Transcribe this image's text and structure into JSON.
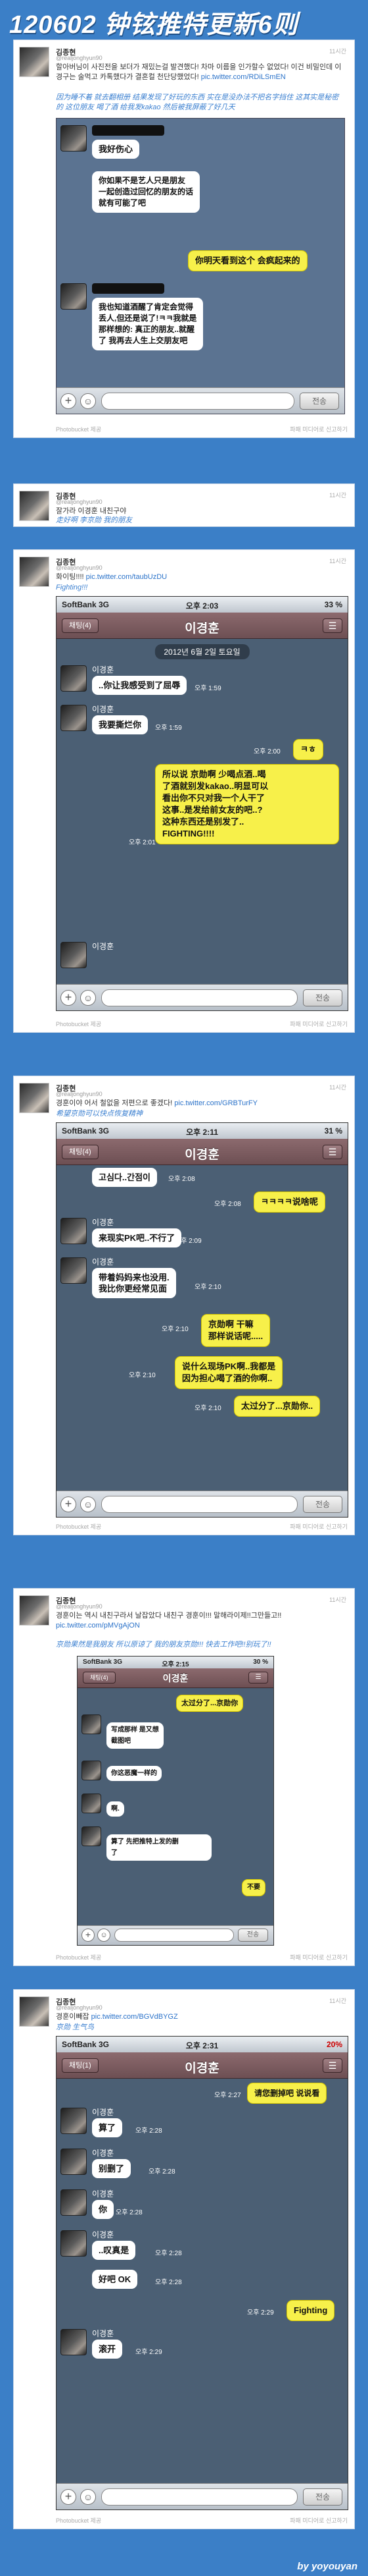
{
  "title": "120602 钟铉推特更新6则",
  "signature": "by yoyouyan",
  "cards": [
    {
      "name": "김종현",
      "id": "@realjonghyun90",
      "age": "11시간",
      "ko": "할아버님이 사진전을 보더가 재밌는걸 발견했다! 차마 이름을 인가할수 없었다! 이건 비밀인데 이경구는 술먹고 카톡했다가 결혼컬 천단당했었다!",
      "link": "pic.twitter.com/RDiLSmEN",
      "zh": "因为睡不着 就去翻相册 结果发现了好玩的东西 实在是没办法不把名字挡住 这其实是秘密的 这位朋友 喝了酒 给我发kakao 然后被我屏蔽了好几天",
      "foot": [
        "Photobucket 제공",
        "파패 미디어로 신고하기"
      ],
      "chat": [
        "我好伤心",
        "你如果不是艺人只是朋友\n一起创造过回忆的朋友的话\n就有可能了吧",
        "你明天看到这个 会疯起来的",
        "我也知道酒醒了肯定会觉得\n丢人,但还是说了!ㅋㅋ我就是\n那样想的: 真正的朋友..就醒\n了 我再去人生上交朋友吧"
      ]
    },
    {
      "name": "김종현",
      "id": "@realjonghyun90",
      "age": "11시간",
      "ko": "잘가라 이경훈 내친구야",
      "zh": "走好啊 李京勋 我的朋友"
    },
    {
      "name": "김종현",
      "id": "@realjonghyun90",
      "age": "11시간",
      "ko": "화이팅!!!! ",
      "link": "pic.twitter.com/taubUzDU",
      "zh": "Fighting!!!",
      "foot": [
        "Photobucket 제공",
        "파패 미디어로 신고하기"
      ],
      "carrier": "SoftBank 3G",
      "time": "오후 2:03",
      "battery": "33 %",
      "back": "채팅(4)",
      "contact": "이경훈",
      "date": "2012년 6월 2일 토요일",
      "msgs": [
        "..你让我感受到了屈辱",
        "我要撕烂你",
        "ㅋㅎ",
        "所以说 京勋啊 少喝点酒..喝\n了酒就别发kakao..明显可以\n看出你不只对我一个人干了\n这事..是发给前女友的吧..?\n这种东西还是别发了..\nFIGHTING!!!!"
      ],
      "times": [
        "오후 1:59",
        "오후 1:59",
        "오후 2:00",
        "오후 2:01"
      ],
      "send": "전송"
    },
    {
      "name": "김종현",
      "id": "@realjonghyun90",
      "age": "11시간",
      "ko": "경훈이야 어서 철없을 저편으로 좋겠다! ",
      "link": "pic.twitter.com/GRBTurFY",
      "zh": "希望京勋可以快点恢复精神",
      "foot": [
        "Photobucket 제공",
        "파패 미디어로 신고하기"
      ],
      "carrier": "SoftBank 3G",
      "time": "오후 2:11",
      "battery": "31 %",
      "back": "채팅(4)",
      "contact": "이경훈",
      "msgs": [
        "고심다..간점이",
        "ㅋㅋㅋㅋ说啥呢",
        "来现实PK吧..不行了",
        "带着妈妈来也没用.\n我比你更经常见面",
        "京勋啊 干嘛\n那样说话呢.....",
        "说什么现场PK啊..我都是\n因为担心喝了酒的你啊..",
        "太过分了...京勋你.."
      ],
      "times": [
        "오후 2:08",
        "오후 2:08",
        "오후 2:09",
        "오후 2:10",
        "오후 2:10",
        "오후 2:10",
        "오후 2:10"
      ],
      "send": "전송"
    },
    {
      "name": "김종현",
      "id": "@realjonghyun90",
      "age": "11시간",
      "ko": "경훈이는 역시 내친구라서 날잡았다 내친구 경훈이!!! 말해라이제!!그만들고!! ",
      "link": "pic.twitter.com/pMVgAjON",
      "zh": "京勋果然是我朋友 所以原谅了 我的朋友京勋!!! 快去工作吧!!别玩了!!",
      "foot": [
        "Photobucket 제공",
        "파패 미디어로 신고하기"
      ],
      "carrier": "SoftBank 3G",
      "time": "오후 2:15",
      "battery": "30 %",
      "back": "채팅(4)",
      "contact": "이경훈",
      "msgs": [
        "太过分了...京勋你",
        "写成那样 是又想\n截图吧",
        "你这恶魔一样的",
        "啊.",
        "算了 先把推特上发的删\n了",
        "不要"
      ],
      "send": "전송"
    },
    {
      "name": "김종현",
      "id": "@realjonghyun90",
      "age": "11시간",
      "ko": "경훈이빼잡 ",
      "link": "pic.twitter.com/BGVdBYGZ",
      "zh": "京勋 生气鸟",
      "foot": [
        "Photobucket 제공",
        "파패 미디어로 신고하기"
      ],
      "carrier": "SoftBank 3G",
      "time": "오후 2:31",
      "battery": "20%",
      "back": "채팅(1)",
      "contact": "이경훈",
      "msgs": [
        "请您删掉吧 说说看",
        "算了",
        "别删了",
        "你",
        "..叹真是",
        "好吧 OK",
        "Fighting",
        "滚开"
      ],
      "times": [
        "오후 2:27",
        "오후 2:28",
        "오후 2:28",
        "오후 2:28",
        "오후 2:28",
        "오후 2:28",
        "오후 2:29",
        "오후 2:29"
      ],
      "send": "전송"
    }
  ]
}
